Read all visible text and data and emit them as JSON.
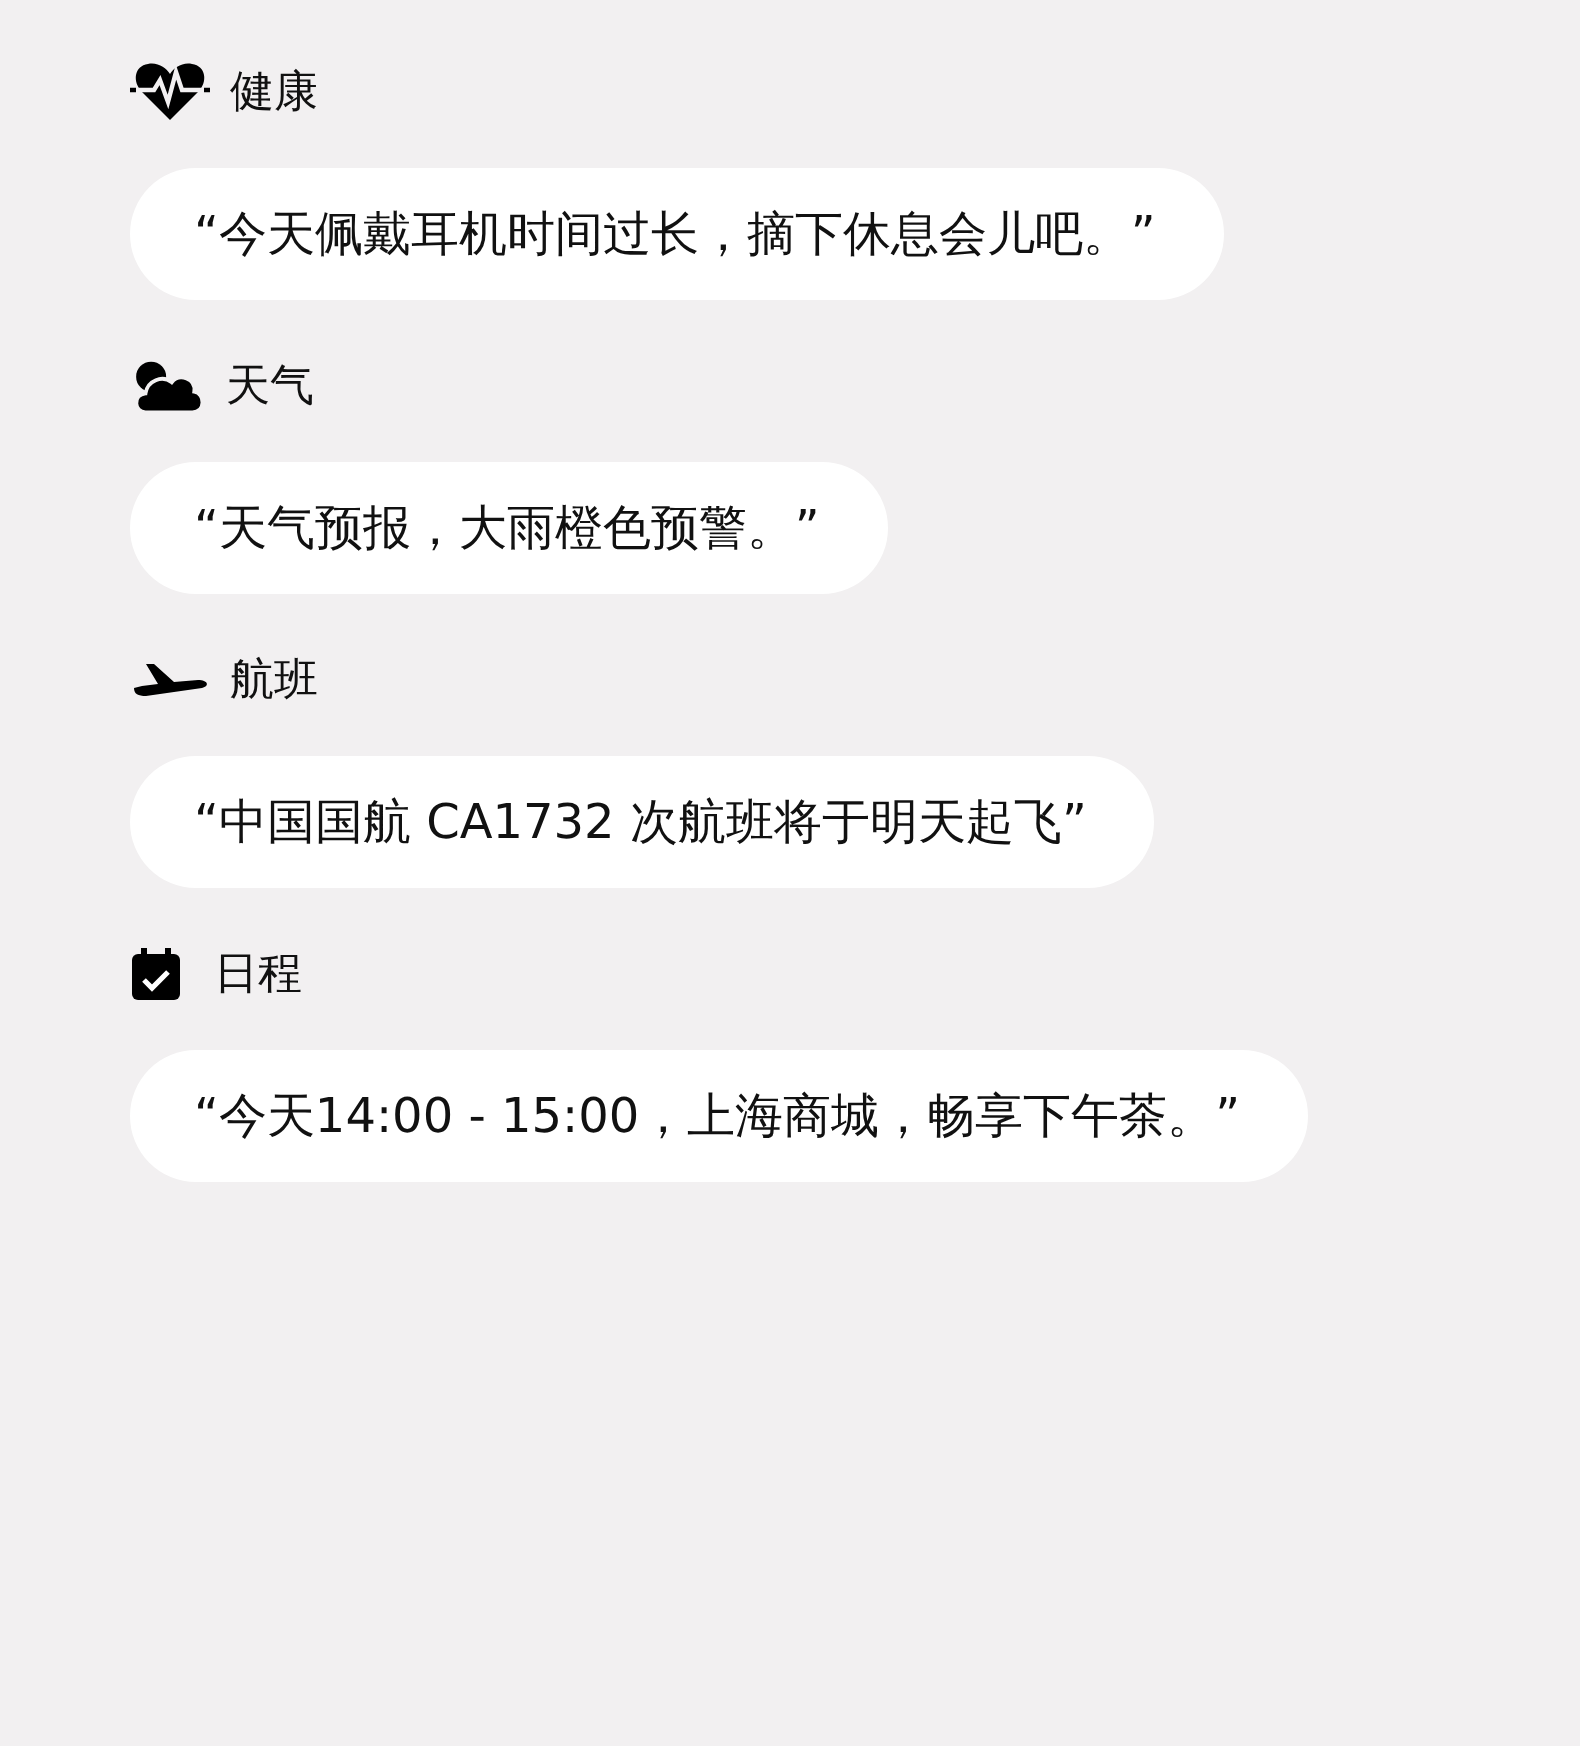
{
  "sections": [
    {
      "kind": "health",
      "title": "健康",
      "message": "“今天佩戴耳机时间过长，摘下休息会儿吧。”"
    },
    {
      "kind": "weather",
      "title": "天气",
      "message": "“天气预报，大雨橙色预警。”"
    },
    {
      "kind": "flight",
      "title": "航班",
      "message": "“中国国航 CA1732 次航班将于明天起飞”"
    },
    {
      "kind": "schedule",
      "title": "日程",
      "message": "“今天14:00 - 15:00，上海商城，畅享下午茶。”"
    }
  ]
}
